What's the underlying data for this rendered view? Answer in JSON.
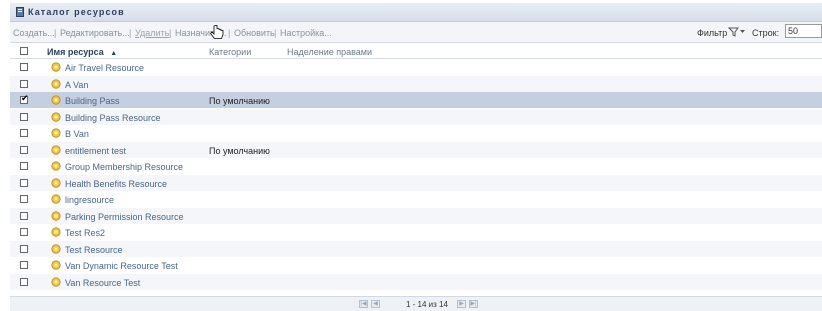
{
  "window": {
    "title": "Каталог ресурсов",
    "title_icon": "catalog-icon"
  },
  "toolbar": {
    "actions": [
      {
        "label": "Создать..."
      },
      {
        "label": "Редактировать..."
      },
      {
        "label": "Удалить"
      },
      {
        "label": "Назначить..."
      },
      {
        "label": "Обновить"
      },
      {
        "label": "Настройка..."
      }
    ],
    "separator": "|",
    "filter_label": "Фильтр",
    "filter_icon": "filter-icon",
    "rows_label": "Строк:",
    "rows_value": "50"
  },
  "table": {
    "headers": {
      "name": "Имя ресурса",
      "sort_indicator": "▲",
      "category": "Категории",
      "entitlement": "Наделение правами"
    },
    "rows": [
      {
        "name": "Air Travel Resource",
        "category": "",
        "checked": false,
        "selected": false
      },
      {
        "name": "A Van",
        "category": "",
        "checked": false,
        "selected": false
      },
      {
        "name": "Building Pass",
        "category": "По умолчанию",
        "checked": true,
        "selected": true
      },
      {
        "name": "Building Pass Resource",
        "category": "",
        "checked": false,
        "selected": false
      },
      {
        "name": "B Van",
        "category": "",
        "checked": false,
        "selected": false
      },
      {
        "name": "entitlement test",
        "category": "По умолчанию",
        "checked": false,
        "selected": false
      },
      {
        "name": "Group Membership Resource",
        "category": "",
        "checked": false,
        "selected": false
      },
      {
        "name": "Health Benefits Resource",
        "category": "",
        "checked": false,
        "selected": false
      },
      {
        "name": "lingresource",
        "category": "",
        "checked": false,
        "selected": false
      },
      {
        "name": "Parking Permission Resource",
        "category": "",
        "checked": false,
        "selected": false
      },
      {
        "name": "Test Res2",
        "category": "",
        "checked": false,
        "selected": false
      },
      {
        "name": "Test Resource",
        "category": "",
        "checked": false,
        "selected": false
      },
      {
        "name": "Van Dynamic Resource Test",
        "category": "",
        "checked": false,
        "selected": false
      },
      {
        "name": "Van Resource Test",
        "category": "",
        "checked": false,
        "selected": false
      }
    ]
  },
  "pagination": {
    "text": "1 - 14 из 14"
  },
  "colors": {
    "selected_row": "#c4d0e1",
    "link": "#4a6685",
    "title": "#2b3f5c"
  }
}
